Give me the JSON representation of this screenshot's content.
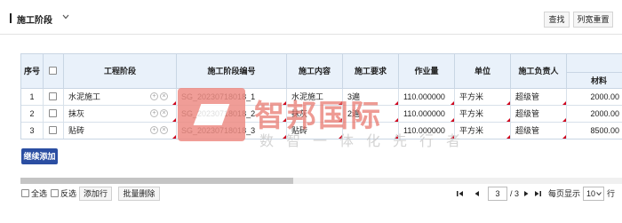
{
  "header": {
    "title": "施工阶段",
    "search_label": "查找",
    "reset_label": "列宽重置"
  },
  "table": {
    "columns": {
      "seq": "序号",
      "stage": "工程阶段",
      "code": "施工阶段编号",
      "content": "施工内容",
      "req": "施工要求",
      "qty": "作业量",
      "unit": "单位",
      "owner": "施工负责人",
      "material": "材料"
    },
    "rows": [
      {
        "seq": "1",
        "stage": "水泥施工",
        "code": "SG_20230718018_1",
        "content": "水泥施工",
        "req": "3遍",
        "qty": "110.000000",
        "unit": "平方米",
        "owner": "超级管",
        "material": "2000.00"
      },
      {
        "seq": "2",
        "stage": "抹灰",
        "code": "SG_20230718018_2",
        "content": "抹灰",
        "req": "2遍",
        "qty": "110.000000",
        "unit": "平方米",
        "owner": "超级管",
        "material": "2000.00"
      },
      {
        "seq": "3",
        "stage": "贴砖",
        "code": "SG_20230718018_3",
        "content": "贴砖",
        "req": "",
        "qty": "110.000000",
        "unit": "平方米",
        "owner": "超级管",
        "material": "8500.00"
      }
    ]
  },
  "continue_add_label": "继续添加",
  "footer": {
    "select_all": "全选",
    "invert": "反选",
    "add_row": "添加行",
    "batch_delete": "批量删除",
    "page_current": "3",
    "page_total": "/ 3",
    "page_size_label": "每页显示",
    "page_size": "10",
    "page_unit": "行"
  },
  "watermark": {
    "brand": "智邦国际",
    "slogan": "数智一体化先行者"
  },
  "colors": {
    "header_bg": "#e9f1fa",
    "grid_border": "#c9d6e4",
    "primary_button": "#2b4ea2",
    "required_mark": "#d0021b",
    "watermark": "#e8756c"
  },
  "icons": [
    "chevron-down-icon",
    "add-circle-icon",
    "remove-circle-icon",
    "first-page-icon",
    "prev-page-icon",
    "next-page-icon",
    "last-page-icon",
    "dropdown-arrow-icon"
  ]
}
